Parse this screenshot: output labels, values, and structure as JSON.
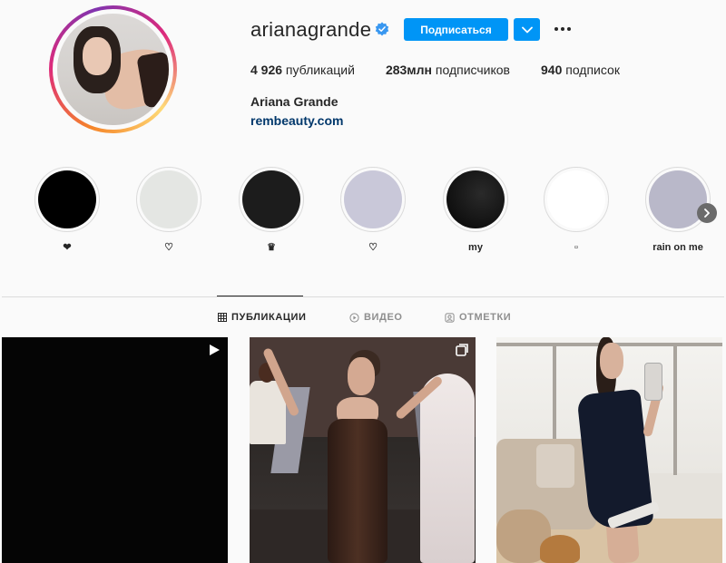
{
  "profile": {
    "username": "arianagrande",
    "follow_label": "Подписаться",
    "full_name": "Ariana Grande",
    "website": "rembeauty.com",
    "stats": [
      {
        "value": "4 926",
        "label": " публикаций"
      },
      {
        "value": "283млн",
        "label": " подписчиков"
      },
      {
        "value": "940",
        "label": " подписок"
      }
    ]
  },
  "highlights": [
    {
      "label": "❤",
      "color": "#000000"
    },
    {
      "label": "♡",
      "color": "#e4e6e3"
    },
    {
      "label": "♛",
      "color": "#1c1c1c"
    },
    {
      "label": "♡",
      "color": "#c9c8d9"
    },
    {
      "label": "my",
      "color": "#0b0b0b"
    },
    {
      "label": "▫",
      "color": "#ffffff"
    },
    {
      "label": "rain on me",
      "color": "#b9b8c9"
    }
  ],
  "tabs": [
    {
      "label": "ПУБЛИКАЦИИ",
      "icon": "grid-icon",
      "active": true
    },
    {
      "label": "ВИДЕО",
      "icon": "video-icon",
      "active": false
    },
    {
      "label": "ОТМЕТКИ",
      "icon": "tagged-icon",
      "active": false
    }
  ],
  "posts": [
    {
      "type": "video",
      "badge": "play-icon",
      "background": "#050505"
    },
    {
      "type": "carousel",
      "badge": "carousel-icon"
    },
    {
      "type": "photo",
      "badge": ""
    }
  ],
  "colors": {
    "accent": "#0095f6",
    "link": "#00376b",
    "verified": "#3897f0"
  }
}
